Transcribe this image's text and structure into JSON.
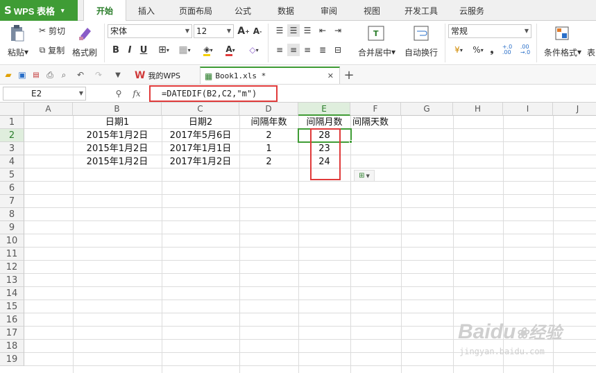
{
  "app": {
    "logo_glyph": "S",
    "title": "WPS 表格",
    "dropdown": "▾"
  },
  "menu": {
    "tabs": [
      "开始",
      "插入",
      "页面布局",
      "公式",
      "数据",
      "审阅",
      "视图",
      "开发工具",
      "云服务"
    ],
    "active": "开始"
  },
  "ribbon": {
    "paste": "粘贴",
    "cut": "剪切",
    "copy": "复制",
    "format_painter": "格式刷",
    "font_name": "宋体",
    "font_size": "12",
    "bold": "B",
    "italic": "I",
    "underline": "U",
    "merge_center": "合并居中",
    "wrap_text": "自动换行",
    "number_format": "常规",
    "percent": "%",
    "comma": "❟",
    "inc_decimal": "+.0\n.00",
    "dec_decimal": ".00\n→.0",
    "conditional_format": "条件格式",
    "table_style": "表"
  },
  "tabs": [
    {
      "label": "我的WPS"
    },
    {
      "label": "Book1.xls *"
    }
  ],
  "formula_bar": {
    "cell_ref": "E2",
    "fx": "fx",
    "formula": "=DATEDIF(B2,C2,\"m\")"
  },
  "sheet": {
    "columns": [
      "A",
      "B",
      "C",
      "D",
      "E",
      "F",
      "G",
      "H",
      "I",
      "J"
    ],
    "selected_column": "E",
    "rows": [
      "1",
      "2",
      "3",
      "4",
      "5",
      "6",
      "7",
      "8",
      "9",
      "10",
      "11",
      "12",
      "13",
      "14",
      "15",
      "16",
      "17",
      "18",
      "19"
    ],
    "selected_row": "2",
    "header_row": {
      "B": "日期1",
      "C": "日期2",
      "D": "间隔年数",
      "E": "间隔月数",
      "F": "间隔天数"
    },
    "data": [
      {
        "B": "2015年1月2日",
        "C": "2017年5月6日",
        "D": "2",
        "E": "28"
      },
      {
        "B": "2015年1月2日",
        "C": "2017年1月1日",
        "D": "1",
        "E": "23"
      },
      {
        "B": "2015年1月2日",
        "C": "2017年1月2日",
        "D": "2",
        "E": "24"
      }
    ]
  },
  "watermark": {
    "brand": "Baidu",
    "cn": "经验",
    "url": "jingyan.baidu.com"
  },
  "colors": {
    "accent": "#3f9c35",
    "highlight": "#e03a3a"
  }
}
